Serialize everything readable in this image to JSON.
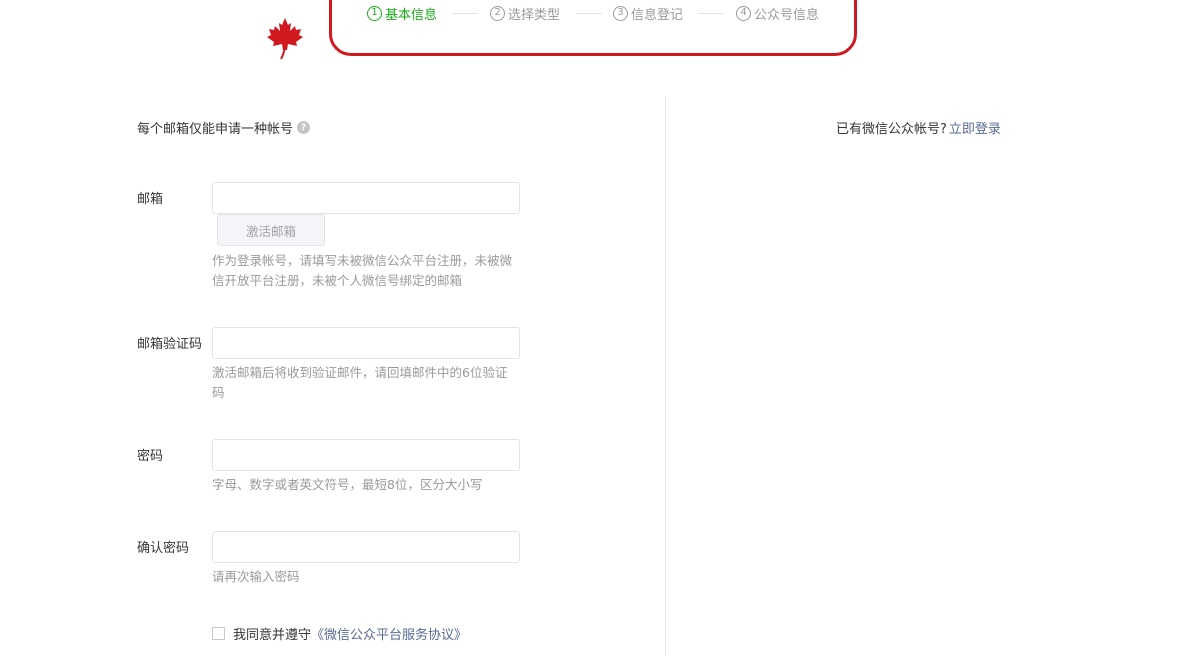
{
  "steps": [
    {
      "num": "1",
      "label": "基本信息",
      "active": true
    },
    {
      "num": "2",
      "label": "选择类型",
      "active": false
    },
    {
      "num": "3",
      "label": "信息登记",
      "active": false
    },
    {
      "num": "4",
      "label": "公众号信息",
      "active": false
    }
  ],
  "colors": {
    "active_step": "#1aad19",
    "link": "#576b95",
    "annotation_border": "#d0191f",
    "maple_leaf": "#d0191f"
  },
  "notice": {
    "text": "每个邮箱仅能申请一种帐号",
    "help_icon": "?"
  },
  "login_hint": {
    "text": "已有微信公众帐号?",
    "link": "立即登录"
  },
  "form": {
    "email": {
      "label": "邮箱",
      "value": "",
      "placeholder": "",
      "activate_button": "激活邮箱",
      "tip": "作为登录帐号，请填写未被微信公众平台注册，未被微信开放平台注册，未被个人微信号绑定的邮箱"
    },
    "code": {
      "label": "邮箱验证码",
      "value": "",
      "placeholder": "",
      "tip": "激活邮箱后将收到验证邮件，请回填邮件中的6位验证码"
    },
    "password": {
      "label": "密码",
      "value": "",
      "placeholder": "",
      "tip": "字母、数字或者英文符号，最短8位，区分大小写"
    },
    "confirm": {
      "label": "确认密码",
      "value": "",
      "placeholder": "",
      "tip": "请再次输入密码"
    },
    "agreement": {
      "prefix": "我同意并遵守",
      "link": "《微信公众平台服务协议》",
      "checked": false
    }
  }
}
